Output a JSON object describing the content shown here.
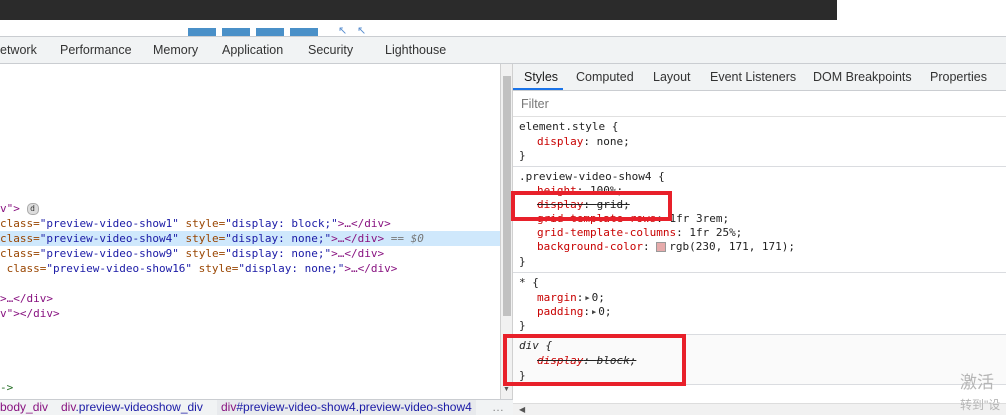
{
  "main_tabs": [
    "etwork",
    "Performance",
    "Memory",
    "Application",
    "Security",
    "Lighthouse"
  ],
  "elements": {
    "badge": "d",
    "line_v": "v\">",
    "rows": [
      {
        "pre": "class=",
        "cls": "\"preview-video-show1\"",
        "mid": " style=",
        "style": "\"display: block;\"",
        "post": ">…</div>"
      },
      {
        "pre": "class=",
        "cls": "\"preview-video-show4\"",
        "mid": " style=",
        "style": "\"display: none;\"",
        "post": ">…</div>",
        "eq": " == $0"
      },
      {
        "pre": "class=",
        "cls": "\"preview-video-show9\"",
        "mid": " style=",
        "style": "\"display: none;\"",
        "post": ">…</div>"
      },
      {
        "pre": " class=",
        "cls": "\"preview-video-show16\"",
        "mid": " style=",
        "style": "\"display: none;\"",
        "post": ">…</div>"
      }
    ],
    "close1": ">…</div>",
    "close2": "v\"></div>",
    "comment": "->"
  },
  "breadcrumb": {
    "items": [
      {
        "tag": "body_div",
        "cls": ""
      },
      {
        "tag": "div",
        "cls": ".preview-videoshow_div"
      },
      {
        "tag": "div",
        "cls": "#preview-video-show4.preview-video-show4"
      }
    ],
    "more": "…"
  },
  "styles": {
    "tabs": [
      "Styles",
      "Computed",
      "Layout",
      "Event Listeners",
      "DOM Breakpoints",
      "Properties"
    ],
    "filter_placeholder": "Filter",
    "element_style": {
      "selector": "element.style {",
      "prop": "display",
      "val": "none;",
      "close": "}"
    },
    "rule2": {
      "selector": ".preview-video-show4 {",
      "height_prop": "height",
      "height_val": "100%;",
      "display_prop": "display",
      "display_val": "grid;",
      "rows_prop": "grid-template-rows",
      "rows_val": "1fr 3rem;",
      "cols_prop": "grid-template-columns",
      "cols_val": "1fr 25%;",
      "bg_prop": "background-color",
      "bg_val": "rgb(230, 171, 171);",
      "close": "}"
    },
    "rule3": {
      "selector": "* {",
      "margin_prop": "margin",
      "margin_val": "0;",
      "padding_prop": "padding",
      "padding_val": "0;",
      "close": "}"
    },
    "rule4": {
      "selector": "div {",
      "prop": "display",
      "val": "block;",
      "close": "}"
    }
  },
  "watermark": {
    "line1": "激活",
    "line2": "转到\"设"
  },
  "colors": {
    "annotation": "#e8202a",
    "swatch": "rgb(230, 171, 171)"
  }
}
